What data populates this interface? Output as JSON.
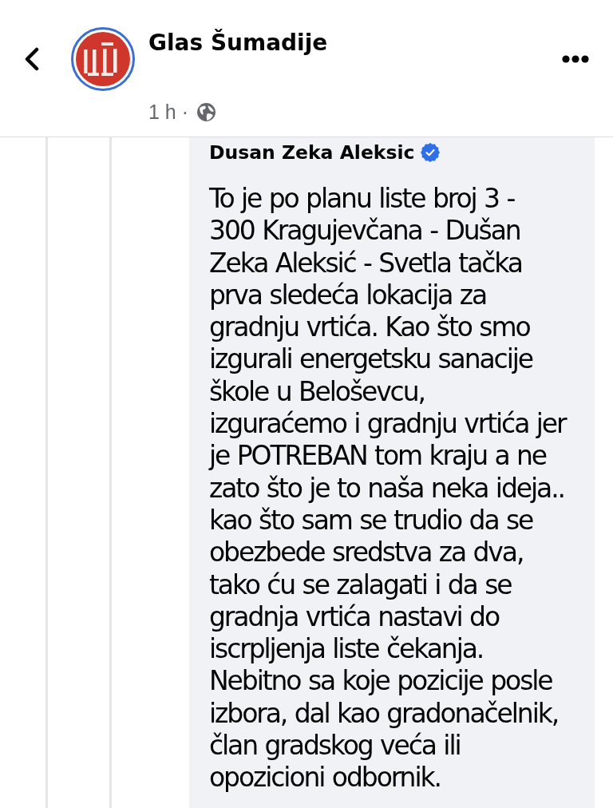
{
  "header": {
    "page_name": "Glas Šumadije",
    "time": "1 h ·"
  },
  "comment": {
    "author": "Dusan Zeka Aleksic",
    "verified": true,
    "text": "To je po planu liste broj 3 - 300 Kragujevčana - Dušan Zeka Aleksić - Svetla tačka prva sledeća lokacija za gradnju vrtića. Kao što smo izgurali energetsku sanacije škole u Beloševcu, izguraćemo i gradnju vrtića jer je POTREBAN tom kraju a ne zato što je to naša neka ideja.. kao što sam se trudio da se obezbede sredstva za dva, tako ću se zalagati i da se gradnja vrtića nastavi do iscrpljenja liste čekanja. Nebitno sa koje pozicije posle izbora, dal kao gradonačelnik, član gradskog veća ili opozicioni odbornik."
  }
}
